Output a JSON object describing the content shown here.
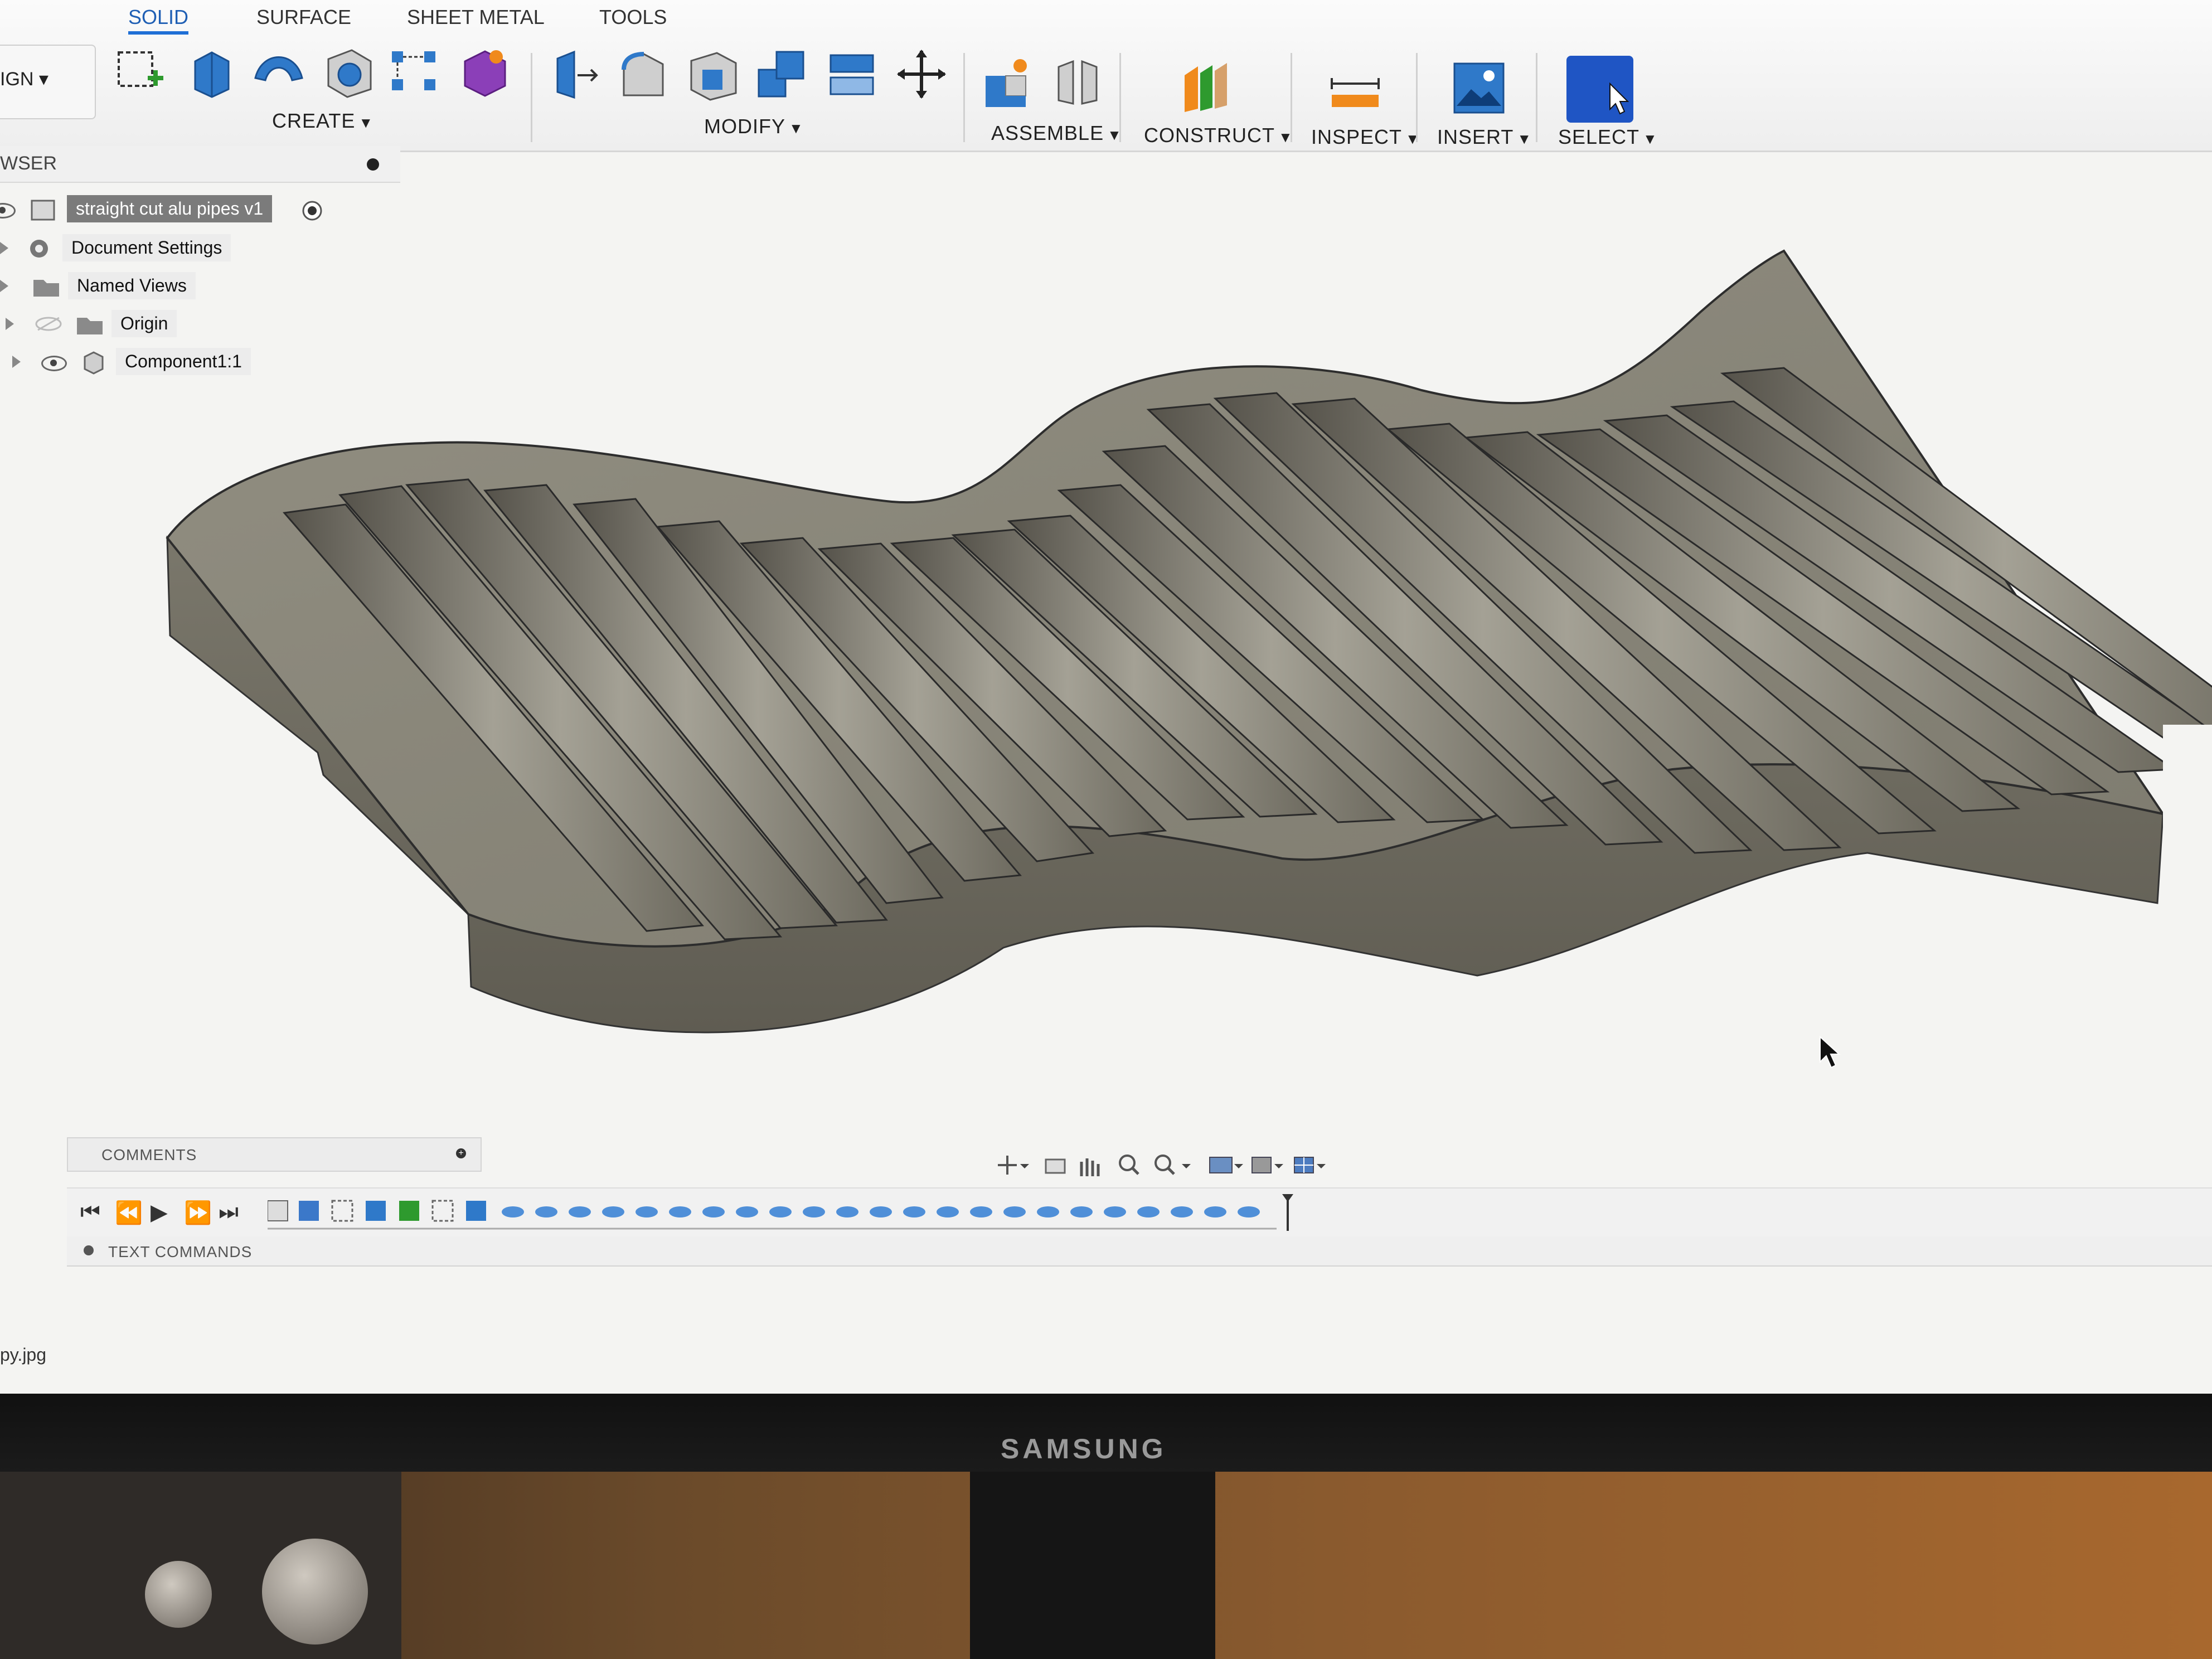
{
  "toolbar": {
    "workspace_label": "IGN ▾",
    "tabs": [
      "SOLID",
      "SURFACE",
      "SHEET METAL",
      "TOOLS"
    ],
    "groups": {
      "create": "CREATE",
      "modify": "MODIFY",
      "assemble": "ASSEMBLE",
      "construct": "CONSTRUCT",
      "inspect": "INSPECT",
      "insert": "INSERT",
      "select": "SELECT"
    }
  },
  "browser": {
    "header": "WSER",
    "items": [
      {
        "label": "straight cut alu pipes v1"
      },
      {
        "label": "Document Settings"
      },
      {
        "label": "Named Views"
      },
      {
        "label": "Origin"
      },
      {
        "label": "Component1:1"
      }
    ]
  },
  "bottom": {
    "comments": "COMMENTS",
    "text_commands": "TEXT COMMANDS",
    "file_tab": "py.jpg"
  },
  "monitor": {
    "brand": "SAMSUNG"
  },
  "colors": {
    "accent": "#1f6fd6",
    "model_top": "#8a877a",
    "model_side": "#6d6a5f"
  }
}
